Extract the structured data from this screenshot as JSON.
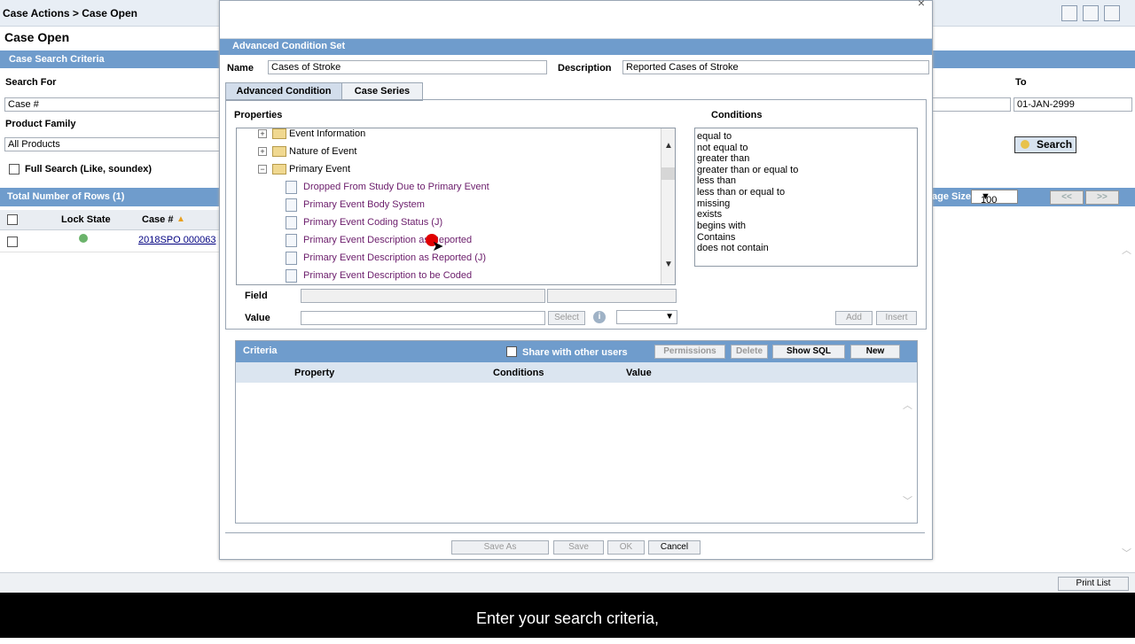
{
  "app": {
    "breadcrumb": "Case Actions > Case Open",
    "page_title": "Case Open",
    "search_criteria_header": "Case Search Criteria",
    "search_for_label": "Search For",
    "search_for_value": "Case #",
    "product_family_label": "Product Family",
    "product_family_value": "All Products",
    "full_search_label": "Full Search (Like, soundex)",
    "to_label": "To",
    "to_value": "01-JAN-2999",
    "search_button": "Search",
    "total_rows_label": "Total Number of Rows  (1)",
    "col_lock_state": "Lock State",
    "col_case_num": "Case #",
    "row_case_num": "2018SPO 000063",
    "page_size_label": "age Size",
    "page_size_value": "100",
    "nav_prev": "<<",
    "nav_next": ">>",
    "print_list": "Print List"
  },
  "dialog": {
    "section_title": "Advanced Condition Set",
    "name_label": "Name",
    "name_value": "Cases of Stroke",
    "description_label": "Description",
    "description_value": "Reported Cases of Stroke",
    "tabs": [
      {
        "label": "Advanced Condition"
      },
      {
        "label": "Case Series"
      }
    ],
    "properties_label": "Properties",
    "conditions_label": "Conditions",
    "tree": [
      {
        "label": "Event Information",
        "kind": "folder"
      },
      {
        "label": "Nature of Event",
        "kind": "folder"
      },
      {
        "label": "Primary Event",
        "kind": "folder-open"
      },
      {
        "label": "Dropped From Study Due to Primary Event",
        "kind": "leaf"
      },
      {
        "label": "Primary Event Body System",
        "kind": "leaf"
      },
      {
        "label": "Primary Event Coding Status (J)",
        "kind": "leaf"
      },
      {
        "label": "Primary Event Description as Reported",
        "kind": "leaf"
      },
      {
        "label": "Primary Event Description as Reported (J)",
        "kind": "leaf"
      },
      {
        "label": "Primary Event Description to be Coded",
        "kind": "leaf"
      }
    ],
    "conditions": [
      "equal to",
      "not equal to",
      "greater than",
      "greater than or equal to",
      "less than",
      "less than or equal to",
      "missing",
      "exists",
      "begins with",
      "Contains",
      "does not contain"
    ],
    "field_label": "Field",
    "value_label": "Value",
    "select_button": "Select",
    "add_button": "Add",
    "insert_button": "Insert",
    "criteria_title": "Criteria",
    "share_label": "Share with other users",
    "permissions_button": "Permissions",
    "delete_button": "Delete",
    "show_sql_button": "Show SQL",
    "new_button": "New",
    "col_property": "Property",
    "col_conditions": "Conditions",
    "col_value": "Value",
    "save_as_button": "Save As",
    "save_button": "Save",
    "ok_button": "OK",
    "cancel_button": "Cancel"
  },
  "caption": "Enter your search criteria,"
}
